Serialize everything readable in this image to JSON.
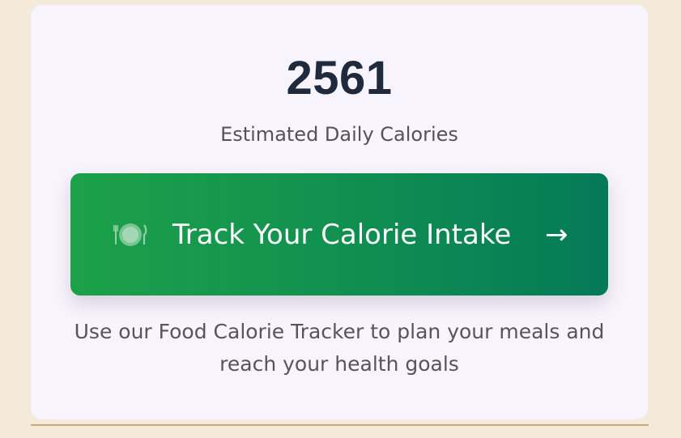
{
  "summary": {
    "calories_value": "2561",
    "calories_label": "Estimated Daily Calories"
  },
  "cta": {
    "icon": "plate-cutlery-icon",
    "label": "Track Your Calorie Intake",
    "arrow": "→"
  },
  "description": "Use our Food Calorie Tracker to plan your meals and reach your health goals",
  "colors": {
    "page_background": "#f3ead9",
    "card_background": "#f8f4fd",
    "value_text": "#1f2a3c",
    "button_gradient_start": "#1ca149",
    "button_gradient_end": "#047a58",
    "divider": "#c8a877"
  }
}
